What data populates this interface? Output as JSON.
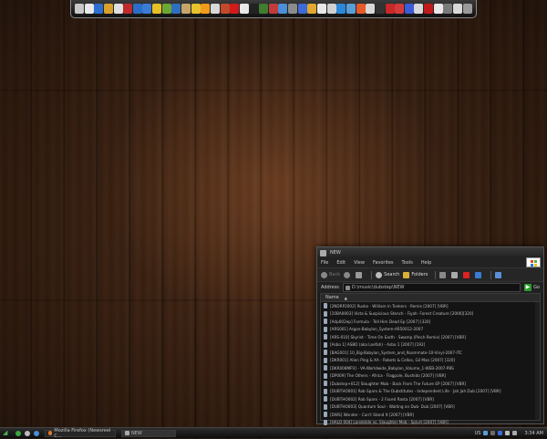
{
  "explorer": {
    "title": "NEW",
    "menu": [
      "File",
      "Edit",
      "View",
      "Favorites",
      "Tools",
      "Help"
    ],
    "toolbar": {
      "back_label": "Back",
      "search_label": "Search",
      "folders_label": "Folders"
    },
    "address": {
      "label": "Address",
      "value": "D:\\music\\dubstep\\NEW",
      "go_label": "Go"
    },
    "columns": {
      "name": "Name"
    },
    "files": [
      "[2NDRP2002] Rusko - William In Tonkers · Remix [2007] [VBR]",
      "[10BA0003] Vista & Suspicious Stench - Fiyah· Forest Creature [2006][320]",
      "[Adp002ep] Formula - Tell Him Dead Ep [2007] [320]",
      "[ARS001] Argon-Babylon_System-AR50012-2007",
      "[ARS-010] Skyrist - Time On Earth · Swamp (Pinch Remix) [2007] [VBR]",
      "[Asbo 1] ASBO (aka Loefah) - Asbo 1 [2007] [192]",
      "[BAG001] 10_Big-Babylon_System_and_Roommate-10-Vinyl-2007-ITC",
      "[DKR001] Alien Ping & XA - Robots & Cellos, Gil Man [2007] [320]",
      "[DKR008MP3] - VA-Worldwide_Babylon_Volume_1-WEB-2007-PBS",
      "[DP009] The Others - Africa · Flagpole, Bushido [2007] [VBR]",
      "[Dubstep+012] Slaughter Mob - Back From The Future EP [2007] [VBR]",
      "[DUBTHO001] Rob Sparx & The Dubstitutes - Independent Life · Jah Jah Dub [2007] [VBR]",
      "[DUBTHO002] Rob Sparx - 2 Faced Rasta [2007] [VBR]",
      "[DUBTHO003] Quantum Soul - Waiting on Dub· Dub [2007] [VBR]",
      "[DWS] Wonder - Can't Stand It [2007] [VBR]",
      "[HALO 004] Landslide vs. Slaughter Mob - Splurt [2007] [VBR]"
    ]
  },
  "taskbar": {
    "tasks": [
      {
        "label": "Mozilla Firefox (Newsreel C...",
        "active": false
      },
      {
        "label": "NEW",
        "active": true
      }
    ],
    "tray": {
      "lang": "US",
      "clock": "3:34 AM"
    }
  },
  "colors": {
    "dock_icons": [
      "#c8c8c8",
      "#e8e8e8",
      "#2d6fd1",
      "#d9a12b",
      "#e0e0e0",
      "#c02a2a",
      "#2b6ec9",
      "#3a7bd5",
      "#e7c026",
      "#6aa833",
      "#2f6fbf",
      "#c7a56a",
      "#e8c22b",
      "#f19a1b",
      "#d8d8d8",
      "#c24a2a",
      "#d11a1a",
      "#e8e8e8",
      "#222222",
      "#3f7d2f",
      "#c23b3b",
      "#4a8fd8",
      "#8c8c8c",
      "#3c6ad8",
      "#e2a82f",
      "#e8e8e8",
      "#d0d0d0",
      "#2b88d8",
      "#5a9ed8",
      "#e65a2a",
      "#d8d8d8",
      "#333333",
      "#c82828",
      "#d43a3a",
      "#3b5bd8",
      "#d8d8d8",
      "#c21a1a",
      "#e8e8e8",
      "#7a7a7a",
      "#d8d8d8",
      "#9a9a9a"
    ]
  }
}
